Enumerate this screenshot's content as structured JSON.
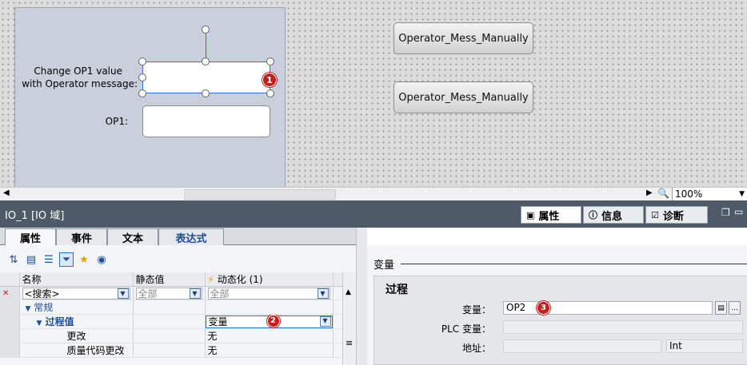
{
  "canvas": {
    "label_change_line1": "Change OP1 value",
    "label_change_line2": "with Operator message:",
    "label_op1": "OP1:",
    "buttons": [
      "Operator_Mess_Manually",
      "Operator_Mess_Manually"
    ],
    "badge1": "1"
  },
  "scrollbar": {
    "zoom": "100%"
  },
  "inspector": {
    "title": "IO_1 [IO 域]",
    "right_tabs": [
      {
        "label": "属性",
        "icon": "properties-icon"
      },
      {
        "label": "信息",
        "icon": "info-icon"
      },
      {
        "label": "诊断",
        "icon": "diagnostics-icon"
      }
    ],
    "tabs": [
      "属性",
      "事件",
      "文本",
      "表达式"
    ],
    "grid": {
      "headers": [
        "名称",
        "静态值",
        "动态化"
      ],
      "dyn_count": "(1)",
      "filter": [
        "<搜索>",
        "全部",
        "全部"
      ],
      "rows": [
        {
          "name": "常规",
          "static": "",
          "dyn": ""
        },
        {
          "name": "过程值",
          "static": "",
          "dyn": "变量"
        },
        {
          "name": "更改",
          "static": "",
          "dyn": "无"
        },
        {
          "name": "质量代码更改",
          "static": "",
          "dyn": "无"
        }
      ],
      "badge2": "2"
    },
    "right": {
      "section": "变量",
      "group": "过程",
      "var_label": "变量：",
      "var_value": "OP2",
      "plc_label": "PLC 变量：",
      "plc_value": "",
      "addr_label": "地址：",
      "addr_value": "",
      "type_value": "Int",
      "badge3": "3"
    }
  },
  "colors": {
    "badge": "#c0201c",
    "title_bar": "#4d5a67",
    "selection": "#3a6fd8"
  }
}
